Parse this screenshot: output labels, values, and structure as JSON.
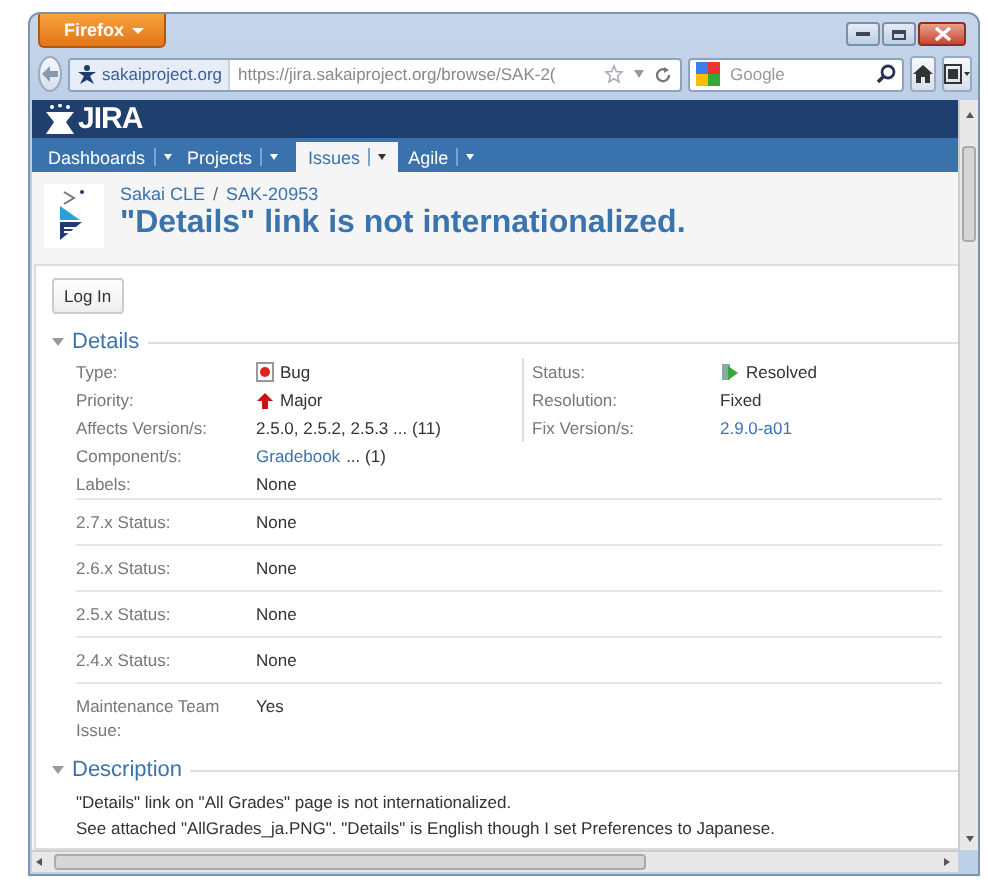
{
  "browser": {
    "menu_button": "Firefox",
    "site_identity": "sakaiproject.org",
    "url": "https://jira.sakaiproject.org/browse/SAK-2(",
    "search_placeholder": "Google"
  },
  "nav": [
    {
      "label": "Dashboards",
      "selected": false
    },
    {
      "label": "Projects",
      "selected": false
    },
    {
      "label": "Issues",
      "selected": true
    },
    {
      "label": "Agile",
      "selected": false
    }
  ],
  "logo_text": "JIRA",
  "breadcrumb": [
    "Sakai CLE",
    "SAK-20953"
  ],
  "breadcrumb_separator": "/",
  "title": "\"Details\" link is not internationalized.",
  "login_button": "Log In",
  "details": {
    "heading": "Details",
    "expanded": true,
    "left": [
      {
        "label": "Type:",
        "value": "Bug",
        "kind": "bug"
      },
      {
        "label": "Priority:",
        "value": "Major",
        "kind": "priority"
      },
      {
        "label": "Affects Version/s:",
        "value": "2.5.0, 2.5.2, 2.5.3 ... (11)",
        "kind": "text"
      },
      {
        "label": "Component/s:",
        "value": "Gradebook",
        "more": "... (1)",
        "kind": "link"
      },
      {
        "label": "Labels:",
        "value": "None",
        "kind": "text"
      }
    ],
    "right": [
      {
        "label": "Status:",
        "value": "Resolved",
        "kind": "resolved"
      },
      {
        "label": "Resolution:",
        "value": "Fixed",
        "kind": "text"
      },
      {
        "label": "Fix Version/s:",
        "value": "2.9.0-a01",
        "kind": "link"
      }
    ],
    "custom": [
      {
        "label": "2.7.x Status:",
        "value": "None"
      },
      {
        "label": "2.6.x Status:",
        "value": "None"
      },
      {
        "label": "2.5.x Status:",
        "value": "None"
      },
      {
        "label": "2.4.x Status:",
        "value": "None"
      },
      {
        "label": "Maintenance Team Issue:",
        "value": "Yes"
      }
    ]
  },
  "description": {
    "heading": "Description",
    "expanded": true,
    "lines": [
      "\"Details\" link on \"All Grades\" page is not internationalized.",
      "See attached \"AllGrades_ja.PNG\". \"Details\" is English though I set Preferences to Japanese."
    ]
  }
}
